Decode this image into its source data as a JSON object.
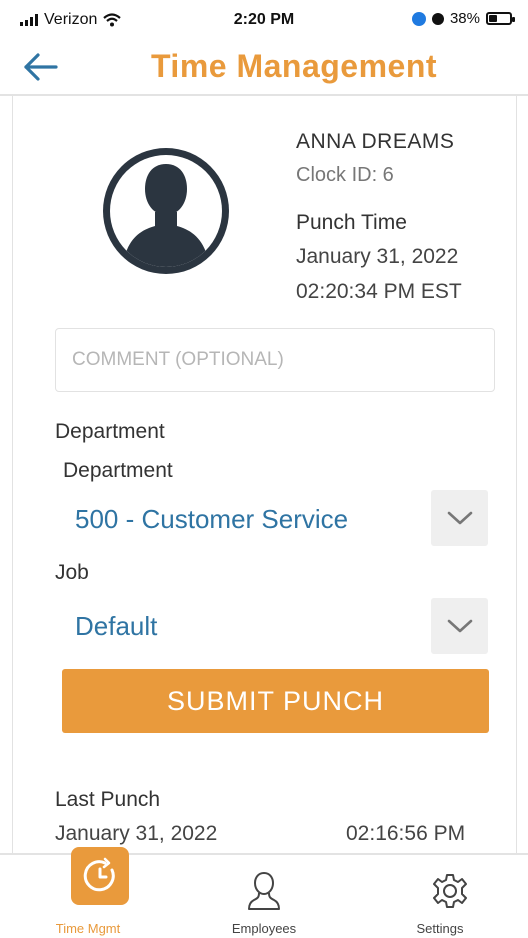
{
  "status_bar": {
    "carrier": "Verizon",
    "time": "2:20 PM",
    "battery": "38%"
  },
  "header": {
    "title": "Time Management",
    "back_icon": "back-arrow-icon"
  },
  "employee": {
    "name": "ANNA DREAMS",
    "clock_id": "Clock ID: 6",
    "punch_time_label": "Punch Time",
    "punch_date": "January 31, 2022",
    "punch_time": "02:20:34 PM EST"
  },
  "form": {
    "comment_placeholder": "COMMENT (OPTIONAL)",
    "comment_value": "",
    "department_section": "Department",
    "department_label": "Department",
    "department_value": "500 - Customer Service",
    "job_label": "Job",
    "job_value": "Default",
    "submit_label": "SUBMIT PUNCH"
  },
  "last_punch": {
    "label": "Last Punch",
    "date": "January 31, 2022",
    "time": "02:16:56 PM"
  },
  "tabs": [
    {
      "label": "Time Mgmt",
      "icon": "clock-icon",
      "active": true
    },
    {
      "label": "Employees",
      "icon": "person-icon",
      "active": false
    },
    {
      "label": "Settings",
      "icon": "gear-icon",
      "active": false
    }
  ],
  "colors": {
    "accent": "#e99a3c",
    "link_blue": "#2f74a3",
    "dark": "#2b3540"
  }
}
